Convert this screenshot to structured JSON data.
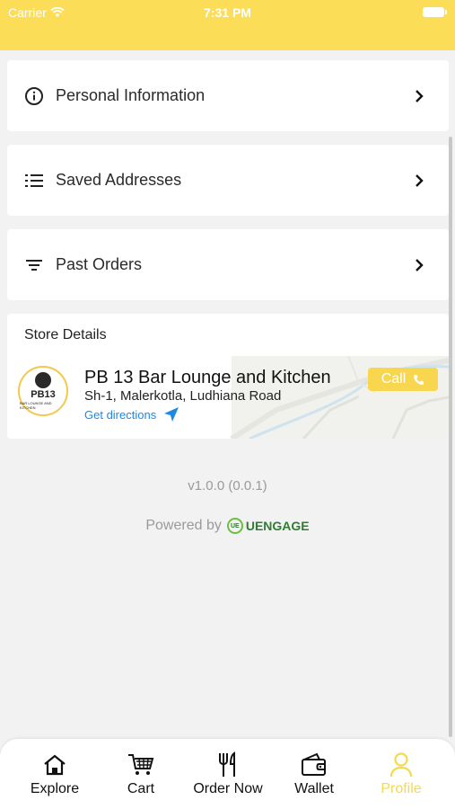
{
  "status": {
    "carrier": "Carrier",
    "time": "7:31 PM"
  },
  "menu": [
    {
      "label": "Personal Information",
      "icon": "info-icon"
    },
    {
      "label": "Saved Addresses",
      "icon": "list-icon"
    },
    {
      "label": "Past Orders",
      "icon": "filter-icon"
    }
  ],
  "store": {
    "section_title": "Store Details",
    "logo_text": "PB13",
    "logo_sub": "BAR LOUNGE AND KITCHEN",
    "name": "PB 13 Bar Lounge and Kitchen",
    "address": "Sh-1, Malerkotla, Ludhiana Road",
    "directions": "Get directions",
    "call_label": "Call"
  },
  "footer": {
    "version": "v1.0.0 (0.0.1)",
    "powered_by": "Powered by",
    "brand_mark": "UE",
    "brand": "UENGAGE"
  },
  "tabs": [
    {
      "label": "Explore",
      "icon": "home-icon"
    },
    {
      "label": "Cart",
      "icon": "cart-icon"
    },
    {
      "label": "Order Now",
      "icon": "fork-knife-icon"
    },
    {
      "label": "Wallet",
      "icon": "wallet-icon"
    },
    {
      "label": "Profile",
      "icon": "profile-icon",
      "active": true
    }
  ],
  "colors": {
    "accent": "#fbdd57",
    "link": "#1e88e5",
    "active_tab": "#f5d94e"
  }
}
